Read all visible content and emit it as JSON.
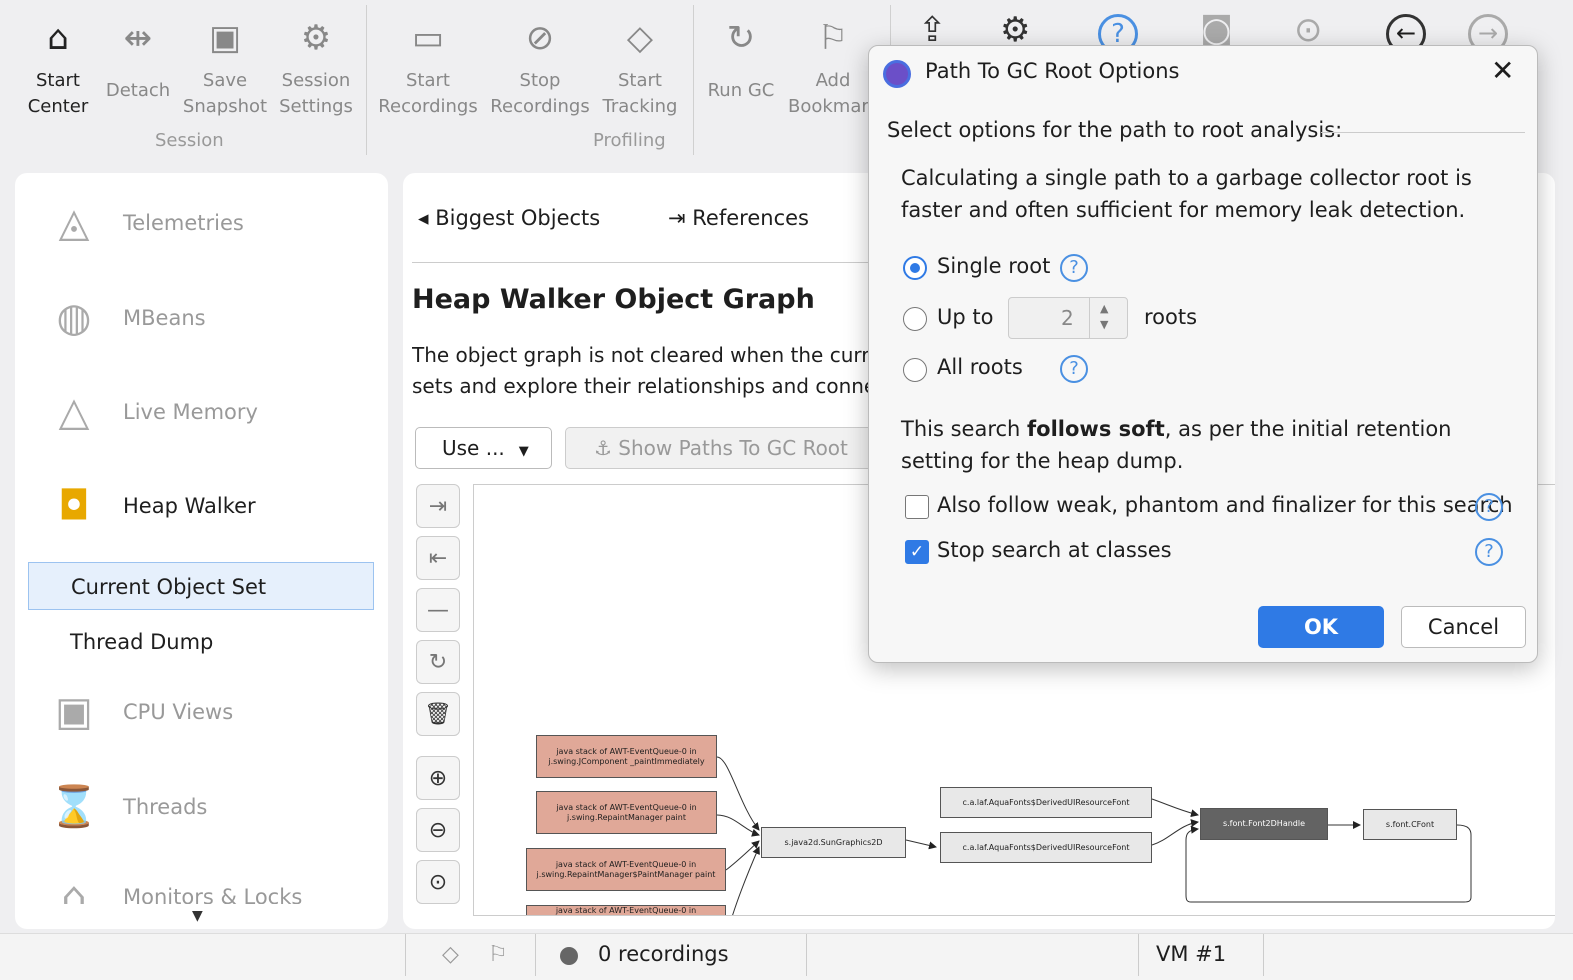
{
  "toolbar": {
    "buttons": [
      {
        "label": "Start\nCenter",
        "icon": "home-icon"
      },
      {
        "label": "Detach",
        "icon": "detach-icon"
      },
      {
        "label": "Save\nSnapshot",
        "icon": "save-icon"
      },
      {
        "label": "Session\nSettings",
        "icon": "gear-icon"
      },
      {
        "label": "Start\nRecordings",
        "icon": "video-icon"
      },
      {
        "label": "Stop\nRecordings",
        "icon": "video-off-icon"
      },
      {
        "label": "Start\nTracking",
        "icon": "tracking-icon"
      },
      {
        "label": "Run GC",
        "icon": "refresh-icon"
      },
      {
        "label": "Add\nBookmark",
        "icon": "bookmark-icon"
      }
    ],
    "groups": {
      "session": "Session",
      "profiling": "Profiling"
    }
  },
  "sidebar": {
    "items": [
      {
        "label": "Telemetries",
        "icon": "telemetries-icon"
      },
      {
        "label": "MBeans",
        "icon": "globe-icon"
      },
      {
        "label": "Live Memory",
        "icon": "shapes-icon"
      },
      {
        "label": "Heap Walker",
        "icon": "camera-icon"
      },
      {
        "label": "CPU Views",
        "icon": "cpu-icon"
      },
      {
        "label": "Threads",
        "icon": "threads-icon"
      },
      {
        "label": "Monitors & Locks",
        "icon": "lock-icon"
      }
    ],
    "sub_items": [
      "Current Object Set",
      "Thread Dump"
    ]
  },
  "main": {
    "tabs": [
      {
        "label": "Biggest Objects"
      },
      {
        "label": "References"
      }
    ],
    "title": "Heap Walker Object Graph",
    "description": [
      "The object graph is not cleared when the curren",
      "sets and explore their relationships and connect"
    ],
    "use_label": "Use ...",
    "show_paths_label": "Show Paths To GC Root"
  },
  "graph": {
    "nodes": [
      "java stack of AWT-EventQueue-0 in j.swing.JComponent _paintImmediately",
      "java stack of AWT-EventQueue-0 in j.swing.RepaintManager paint",
      "java stack of AWT-EventQueue-0 in j.swing.RepaintManager$PaintManager paint",
      "java stack of AWT-EventQueue-0 in",
      "s.java2d.SunGraphics2D",
      "c.a.laf.AquaFonts$DerivedUIResourceFont",
      "c.a.laf.AquaFonts$DerivedUIResourceFont",
      "s.font.Font2DHandle",
      "s.font.CFont"
    ]
  },
  "dialog": {
    "title": "Path To GC Root Options",
    "section": "Select options for the path to root analysis:",
    "intro": "Calculating a single path to a garbage collector root is faster and often sufficient for memory leak detection.",
    "single_root": "Single root",
    "up_to": "Up to",
    "up_to_value": "2",
    "roots": "roots",
    "all_roots": "All roots",
    "selected": "single_root",
    "search_pre": "This search ",
    "search_bold": "follows soft",
    "search_post": ", as per the initial retention setting for the heap dump.",
    "weak_label": "Also follow weak, phantom and finalizer for this search",
    "weak_checked": false,
    "stop_label": "Stop search at classes",
    "stop_checked": true,
    "ok": "OK",
    "cancel": "Cancel",
    "accent": "#2f7ae5"
  },
  "status": {
    "recordings": "0 recordings",
    "vm": "VM #1"
  }
}
